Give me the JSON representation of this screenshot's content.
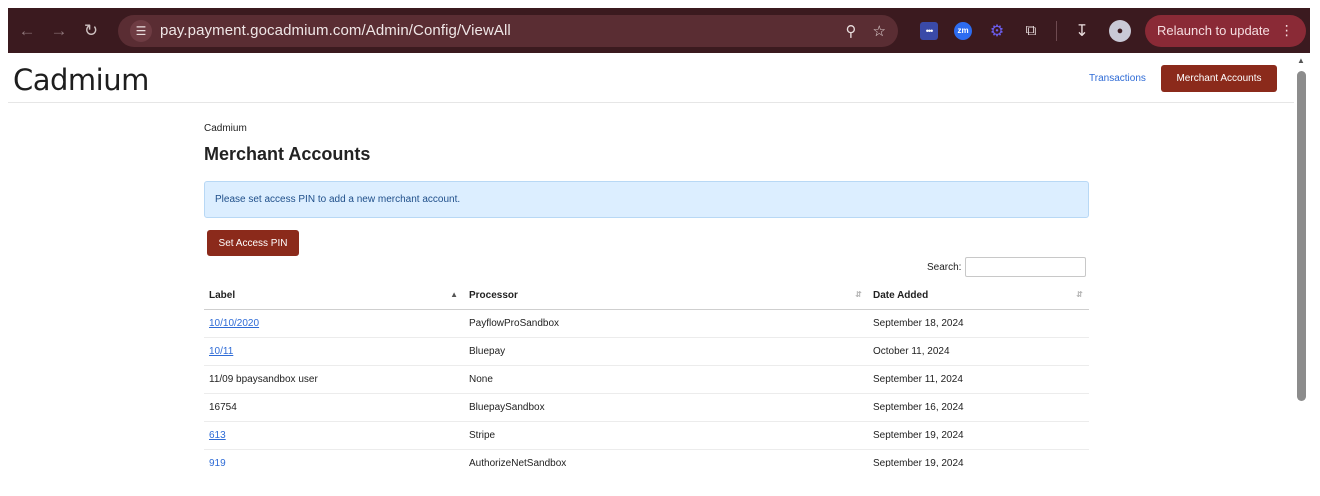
{
  "browser": {
    "url": "pay.payment.gocadmium.com/Admin/Config/ViewAll",
    "relaunch_label": "Relaunch to update",
    "ext_zoom_label": "zm"
  },
  "header": {
    "logo": "Cadmium",
    "nav_transactions": "Transactions",
    "nav_merchant_accounts": "Merchant Accounts"
  },
  "main": {
    "breadcrumb": "Cadmium",
    "title": "Merchant Accounts",
    "alert": "Please set access PIN to add a new merchant account.",
    "set_pin_label": "Set Access PIN",
    "search_label": "Search:",
    "search_value": "",
    "columns": [
      "Label",
      "Processor",
      "Date Added"
    ],
    "rows": [
      {
        "label": "10/10/2020",
        "processor": "PayflowProSandbox",
        "date": "September 18, 2024",
        "link": true
      },
      {
        "label": "10/11",
        "processor": "Bluepay",
        "date": "October 11, 2024",
        "link": true
      },
      {
        "label": "11/09 bpaysandbox user",
        "processor": "None",
        "date": "September 11, 2024",
        "link": false
      },
      {
        "label": "16754",
        "processor": "BluepaySandbox",
        "date": "September 16, 2024",
        "link": false
      },
      {
        "label": "613",
        "processor": "Stripe",
        "date": "September 19, 2024",
        "link": true
      },
      {
        "label": "919",
        "processor": "AuthorizeNetSandbox",
        "date": "September 19, 2024",
        "link": true
      }
    ]
  },
  "colors": {
    "brand": "#8b2a1b",
    "link": "#2e6bd6",
    "chrome_bg": "#3b1a1f"
  }
}
